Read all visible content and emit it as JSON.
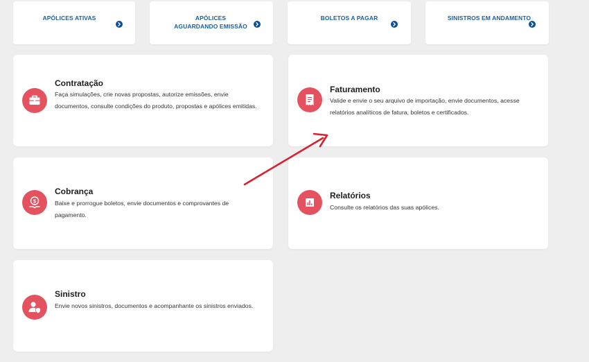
{
  "quick_links": [
    {
      "label": "APÓLICES ATIVAS",
      "icon": "chevron-right-circle-icon"
    },
    {
      "label": "APÓLICES AGUARDANDO EMISSÃO",
      "icon": "chevron-right-circle-icon"
    },
    {
      "label": "BOLETOS A PAGAR",
      "icon": "chevron-right-circle-icon"
    },
    {
      "label": "SINISTROS EM ANDAMENTO",
      "icon": "chevron-right-circle-icon"
    }
  ],
  "cards": {
    "contratacao": {
      "title": "Contratação",
      "description": "Faça simulações, crie novas propostas, autorize emissões, envie documentos, consulte condições do produto, propostas e apólices emitidas.",
      "icon": "briefcase-icon"
    },
    "faturamento": {
      "title": "Faturamento",
      "description": "Valide e envie o seu arquivo de importação, envie documentos, acesse relatórios analíticos de fatura, boletos e certificados.",
      "icon": "invoice-icon"
    },
    "cobranca": {
      "title": "Cobrança",
      "description": "Baixe e prorrogue boletos, envie documentos e comprovantes de pagamento.",
      "icon": "money-hand-icon"
    },
    "relatorios": {
      "title": "Relatórios",
      "description": "Consulte os relatórios das suas apólices.",
      "icon": "bar-chart-icon"
    },
    "sinistro": {
      "title": "Sinistro",
      "description": "Envie novos sinistros, documentos e acompanhante os sinistros enviados.",
      "icon": "user-shield-icon"
    }
  },
  "colors": {
    "background": "#efeeef",
    "card": "#ffffff",
    "accent_red": "#e5525f",
    "link_blue": "#1a5fa0",
    "annotation_arrow": "#d8202e"
  }
}
